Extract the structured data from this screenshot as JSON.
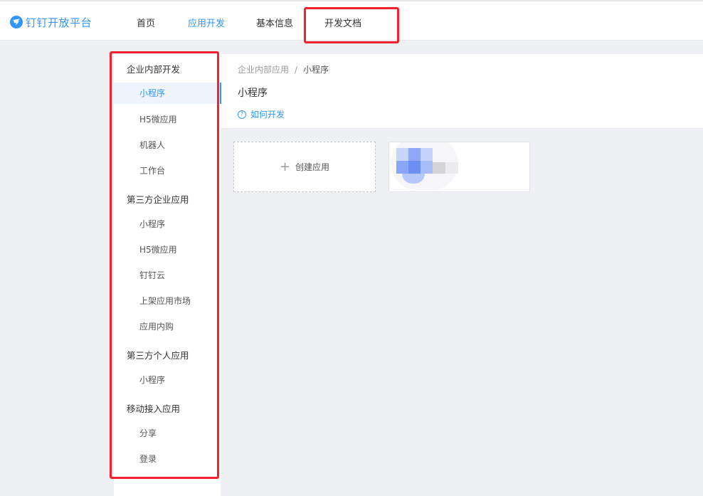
{
  "brand": {
    "name": "钉钉开放平台",
    "color": "#3296fa",
    "icon": "dingtalk-logo-icon"
  },
  "topnav": {
    "items": [
      {
        "label": "首页",
        "active": false
      },
      {
        "label": "应用开发",
        "active": true
      },
      {
        "label": "基本信息",
        "active": false
      },
      {
        "label": "开发文档",
        "active": false,
        "highlighted": true
      }
    ]
  },
  "sidebar": {
    "groups": [
      {
        "label": "企业内部开发",
        "items": [
          {
            "label": "小程序",
            "active": true
          },
          {
            "label": "H5微应用"
          },
          {
            "label": "机器人"
          },
          {
            "label": "工作台"
          }
        ]
      },
      {
        "label": "第三方企业应用",
        "items": [
          {
            "label": "小程序"
          },
          {
            "label": "H5微应用"
          },
          {
            "label": "钉钉云"
          },
          {
            "label": "上架应用市场"
          },
          {
            "label": "应用内购"
          }
        ]
      },
      {
        "label": "第三方个人应用",
        "items": [
          {
            "label": "小程序"
          }
        ]
      },
      {
        "label": "移动接入应用",
        "items": [
          {
            "label": "分享"
          },
          {
            "label": "登录"
          }
        ]
      }
    ]
  },
  "breadcrumb": {
    "parent": "企业内部应用",
    "separator": "/",
    "current": "小程序"
  },
  "page": {
    "title": "小程序",
    "howto_label": "如何开发",
    "howto_icon": "question-circle-icon"
  },
  "cards": {
    "create_label": "创建应用",
    "create_icon": "plus-icon"
  },
  "colors": {
    "accent": "#3296fa",
    "highlight_border": "#f5222d",
    "background": "#eff0f4"
  }
}
